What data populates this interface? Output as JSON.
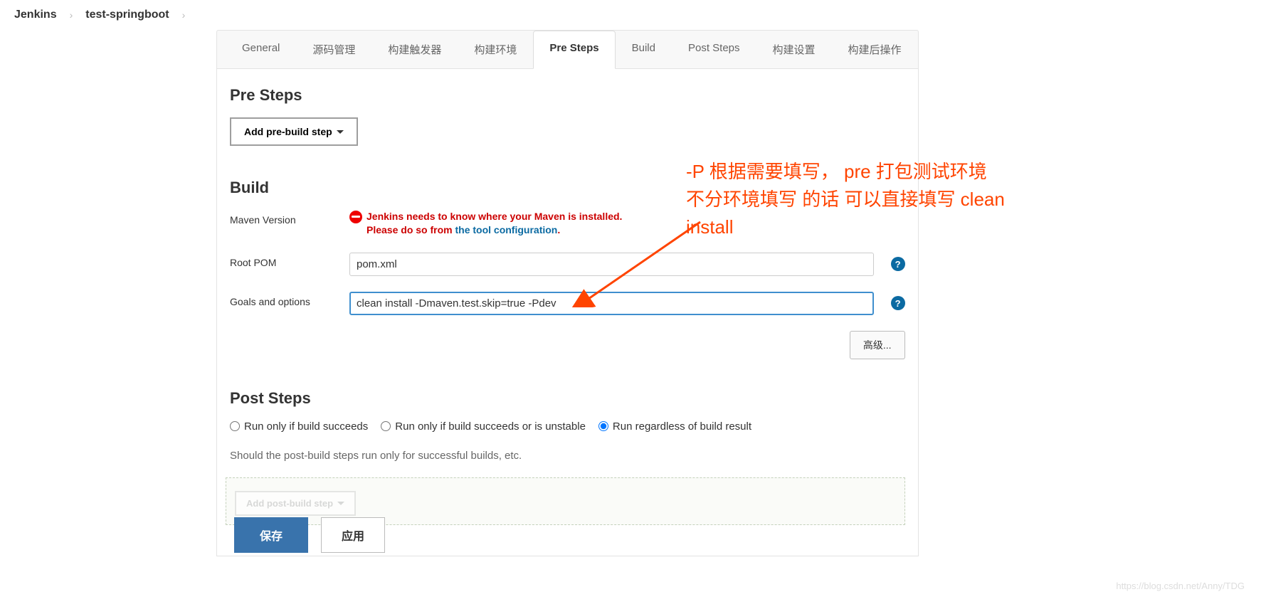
{
  "breadcrumb": {
    "root": "Jenkins",
    "project": "test-springboot"
  },
  "tabs": {
    "items": [
      "General",
      "源码管理",
      "构建触发器",
      "构建环境",
      "Pre Steps",
      "Build",
      "Post Steps",
      "构建设置",
      "构建后操作"
    ],
    "active": "Pre Steps"
  },
  "preSteps": {
    "title": "Pre Steps",
    "addButton": "Add pre-build step"
  },
  "build": {
    "title": "Build",
    "mavenVersionLabel": "Maven Version",
    "errorLine1": "Jenkins needs to know where your Maven is installed.",
    "errorLine2a": "Please do so from ",
    "errorLink": "the tool configuration",
    "errorLine2b": ".",
    "rootPomLabel": "Root POM",
    "rootPomValue": "pom.xml",
    "goalsLabel": "Goals and options",
    "goalsValue": "clean install -Dmaven.test.skip=true -Pdev",
    "advancedButton": "高级..."
  },
  "postSteps": {
    "title": "Post Steps",
    "radio1": "Run only if build succeeds",
    "radio2": "Run only if build succeeds or is unstable",
    "radio3": "Run regardless of build result",
    "helpText": "Should the post-build steps run only for successful builds, etc.",
    "addButton": "Add post-build step"
  },
  "buttons": {
    "save": "保存",
    "apply": "应用"
  },
  "annotation": {
    "line1": "-P 根据需要填写， pre 打包测试环境",
    "line2": "不分环境填写 的话 可以直接填写 clean install"
  },
  "watermark": "https://blog.csdn.net/Anny/TDG"
}
